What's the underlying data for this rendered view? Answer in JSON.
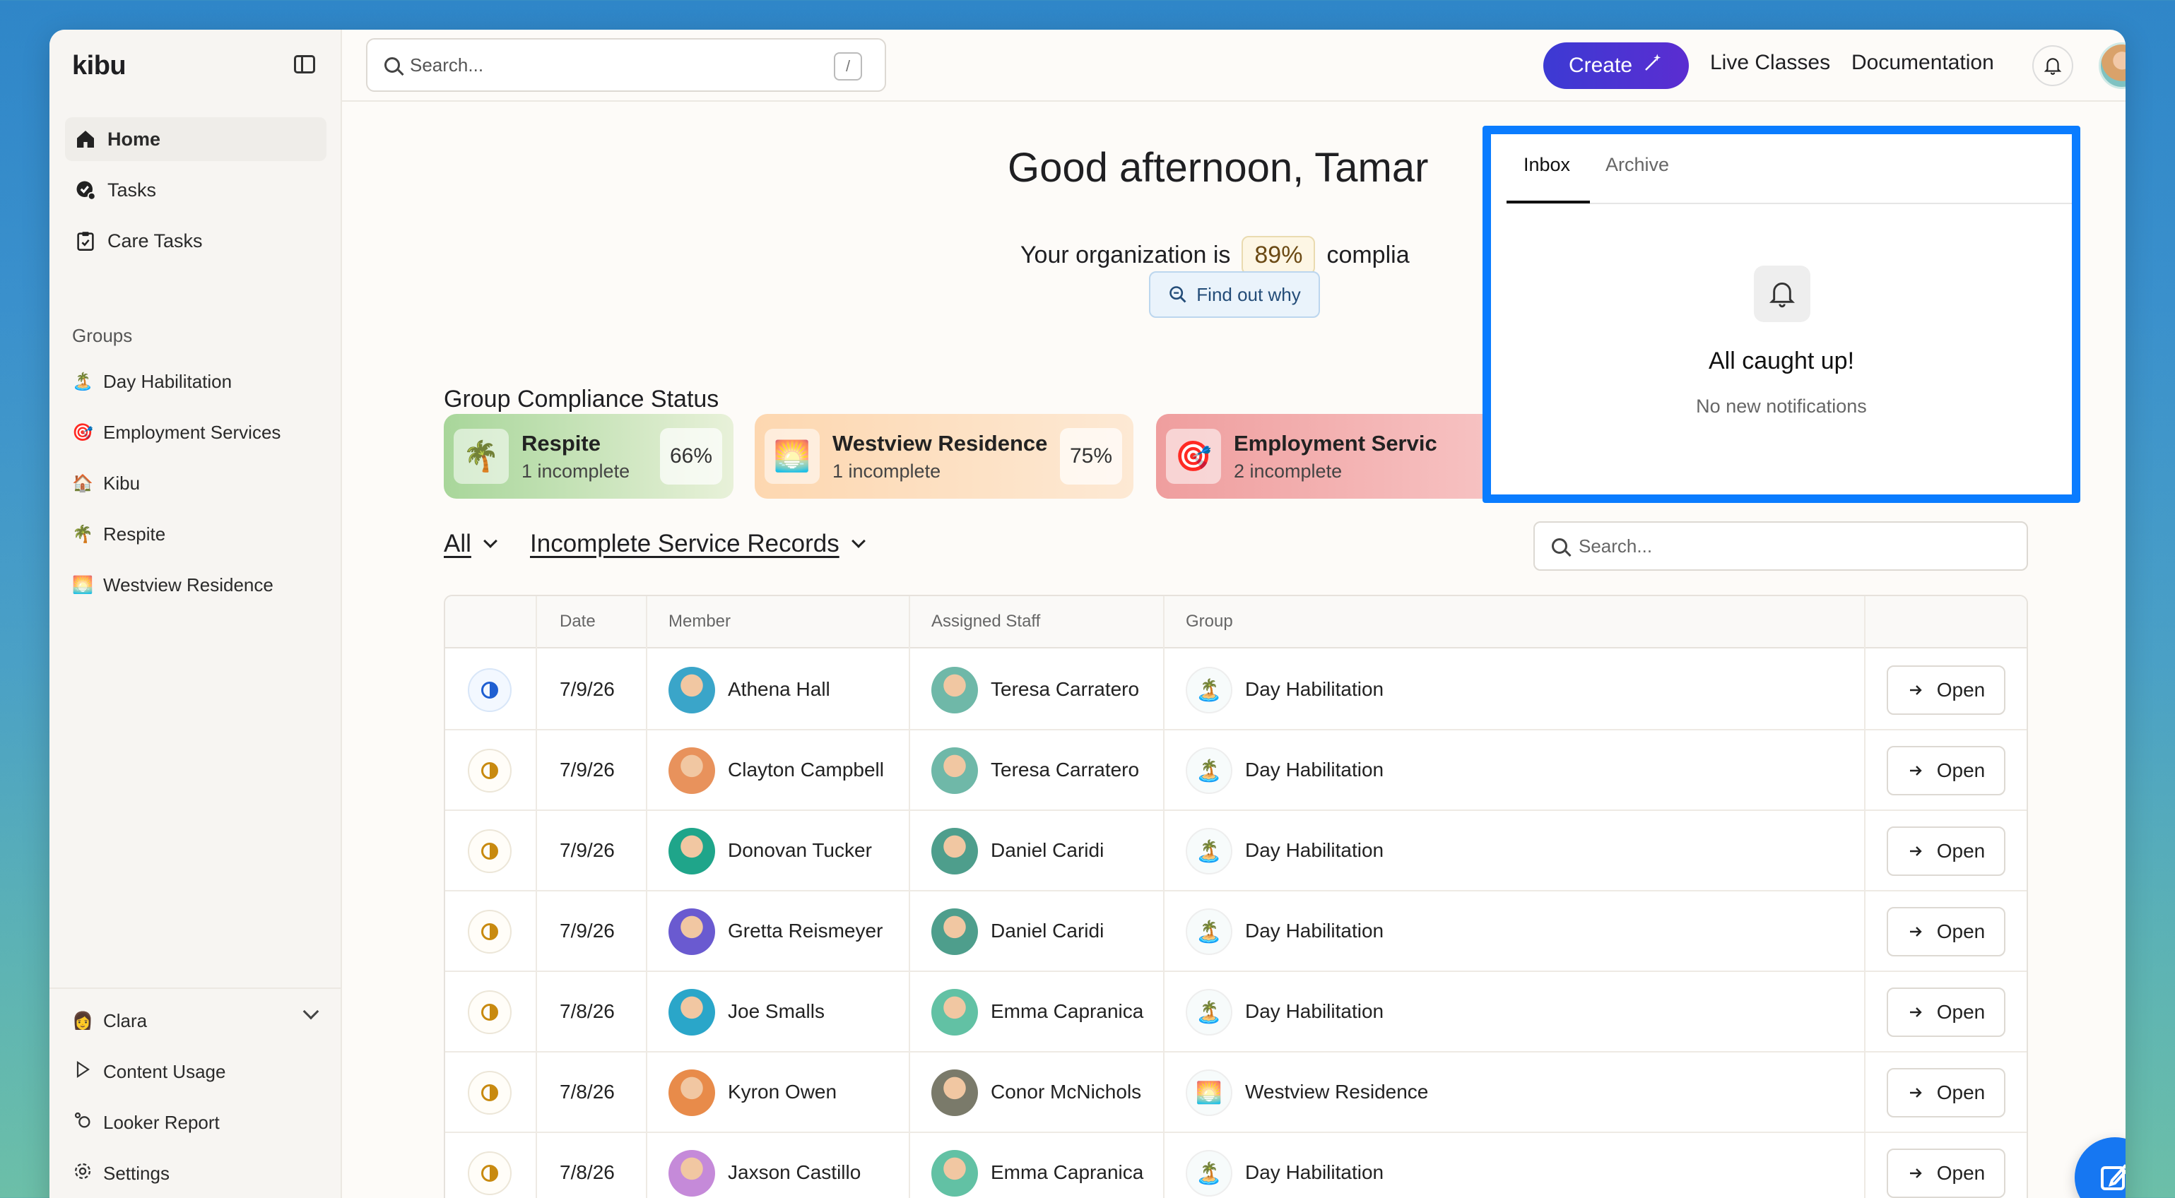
{
  "app": {
    "brand": "kibu"
  },
  "sidebar": {
    "nav": [
      {
        "label": "Home",
        "icon": "home-icon"
      },
      {
        "label": "Tasks",
        "icon": "tasks-check-icon"
      },
      {
        "label": "Care Tasks",
        "icon": "clipboard-icon"
      }
    ],
    "groups_label": "Groups",
    "groups": [
      {
        "label": "Day Habilitation",
        "emoji": "🏝️"
      },
      {
        "label": "Employment Services",
        "emoji": "🎯"
      },
      {
        "label": "Kibu",
        "emoji": "🏠"
      },
      {
        "label": "Respite",
        "emoji": "🌴"
      },
      {
        "label": "Westview Residence",
        "emoji": "🌅"
      }
    ],
    "user": {
      "name": "Clara",
      "emoji": "👩"
    },
    "bottom": [
      {
        "label": "Content Usage",
        "icon": "play-icon"
      },
      {
        "label": "Looker Report",
        "icon": "looker-icon"
      },
      {
        "label": "Settings",
        "icon": "gear-icon"
      }
    ]
  },
  "topbar": {
    "search_placeholder": "Search...",
    "search_shortcut": "/",
    "create_label": "Create",
    "links": [
      "Live Classes",
      "Documentation"
    ]
  },
  "main": {
    "greeting": "Good afternoon, Tamar",
    "compliance_prefix": "Your organization is",
    "compliance_pct": "89%",
    "compliance_suffix": "complia",
    "find_out_label": "Find out why",
    "section_title": "Group Compliance Status",
    "cards": [
      {
        "name": "Respite",
        "sub": "1 incomplete",
        "pct": "66%",
        "emoji": "🌴",
        "bg": "#cfe6c0"
      },
      {
        "name": "Westview Residence",
        "sub": "1 incomplete",
        "pct": "75%",
        "emoji": "🌅",
        "bg": "#fde2c8"
      },
      {
        "name": "Employment Servic",
        "sub": "2 incomplete",
        "pct": "",
        "emoji": "🎯",
        "bg": "#f3b4b4"
      }
    ],
    "filter_all": "All",
    "filter_records": "Incomplete Service Records",
    "table_search_placeholder": "Search...",
    "columns": [
      "Date",
      "Member",
      "Assigned Staff",
      "Group"
    ],
    "rows": [
      {
        "status": "blue",
        "date": "7/9/26",
        "member": "Athena Hall",
        "staff": "Teresa Carratero",
        "group": "Day Habilitation",
        "gemoji": "🏝️",
        "mcol": "#3aa5c9",
        "scol": "#6fb8a8"
      },
      {
        "status": "amber",
        "date": "7/9/26",
        "member": "Clayton Campbell",
        "staff": "Teresa Carratero",
        "group": "Day Habilitation",
        "gemoji": "🏝️",
        "mcol": "#e8925c",
        "scol": "#6fb8a8"
      },
      {
        "status": "amber",
        "date": "7/9/26",
        "member": "Donovan Tucker",
        "staff": "Daniel Caridi",
        "group": "Day Habilitation",
        "gemoji": "🏝️",
        "mcol": "#1fa58a",
        "scol": "#4e9e8c"
      },
      {
        "status": "amber",
        "date": "7/9/26",
        "member": "Gretta Reismeyer",
        "staff": "Daniel Caridi",
        "group": "Day Habilitation",
        "gemoji": "🏝️",
        "mcol": "#6a5ad0",
        "scol": "#4e9e8c"
      },
      {
        "status": "amber",
        "date": "7/8/26",
        "member": "Joe Smalls",
        "staff": "Emma Capranica",
        "group": "Day Habilitation",
        "gemoji": "🏝️",
        "mcol": "#2aa6c9",
        "scol": "#62c1a4"
      },
      {
        "status": "amber",
        "date": "7/8/26",
        "member": "Kyron Owen",
        "staff": "Conor McNichols",
        "group": "Westview Residence",
        "gemoji": "🌅",
        "mcol": "#e88b4a",
        "scol": "#7a7a6a"
      },
      {
        "status": "amber",
        "date": "7/8/26",
        "member": "Jaxson Castillo",
        "staff": "Emma Capranica",
        "group": "Day Habilitation",
        "gemoji": "🏝️",
        "mcol": "#c58ad9",
        "scol": "#62c1a4"
      }
    ],
    "open_label": "Open"
  },
  "notifications": {
    "tabs": [
      "Inbox",
      "Archive"
    ],
    "title": "All caught up!",
    "subtitle": "No new notifications"
  }
}
